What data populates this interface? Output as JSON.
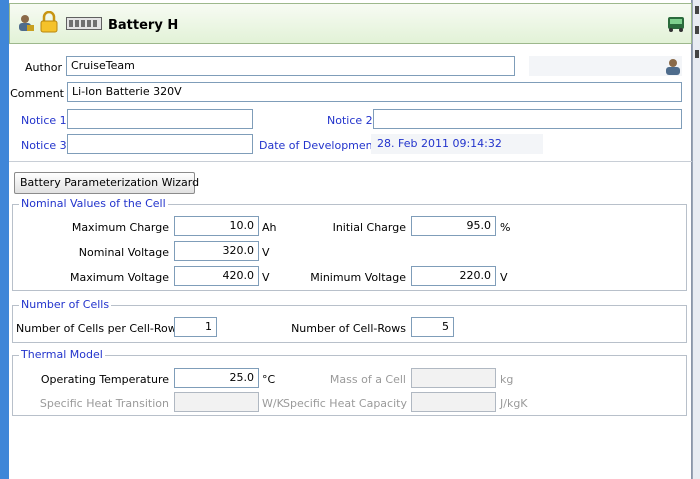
{
  "header": {
    "title": "Battery H",
    "icons": [
      "user-settings-icon",
      "lock-icon",
      "battery-icon",
      "device-icon"
    ]
  },
  "author": {
    "label": "Author",
    "value": "CruiseTeam",
    "icon": "user-icon"
  },
  "comment": {
    "label": "Comment",
    "value": "Li-Ion Batterie 320V"
  },
  "notice1": {
    "label": "Notice 1",
    "value": ""
  },
  "notice2": {
    "label": "Notice 2",
    "value": ""
  },
  "notice3": {
    "label": "Notice 3",
    "value": ""
  },
  "date": {
    "label": "Date of Development",
    "value": "28. Feb 2011 09:14:32"
  },
  "wizard_button": "Battery Parameterization Wizard",
  "nominal": {
    "title": "Nominal Values of the Cell",
    "max_charge": {
      "label": "Maximum Charge",
      "value": "10.0",
      "unit": "Ah"
    },
    "initial_charge": {
      "label": "Initial Charge",
      "value": "95.0",
      "unit": "%"
    },
    "nominal_voltage": {
      "label": "Nominal Voltage",
      "value": "320.0",
      "unit": "V"
    },
    "max_voltage": {
      "label": "Maximum Voltage",
      "value": "420.0",
      "unit": "V"
    },
    "min_voltage": {
      "label": "Minimum Voltage",
      "value": "220.0",
      "unit": "V"
    }
  },
  "cells": {
    "title": "Number of Cells",
    "per_row": {
      "label": "Number of Cells per Cell-Row",
      "value": "1"
    },
    "rows": {
      "label": "Number of Cell-Rows",
      "value": "5"
    }
  },
  "thermal": {
    "title": "Thermal Model",
    "op_temp": {
      "label": "Operating Temperature",
      "value": "25.0",
      "unit": "°C"
    },
    "cell_mass": {
      "label": "Mass of a Cell",
      "value": "",
      "unit": "kg"
    },
    "heat_transition": {
      "label": "Specific Heat Transition",
      "value": "",
      "unit": "W/K"
    },
    "heat_capacity": {
      "label": "Specific Heat Capacity",
      "value": "",
      "unit": "J/kgK"
    }
  },
  "colors": {
    "accent": "#2233cc",
    "header_bg": "#e2f2d7",
    "left_bar": "#3f86d8"
  }
}
